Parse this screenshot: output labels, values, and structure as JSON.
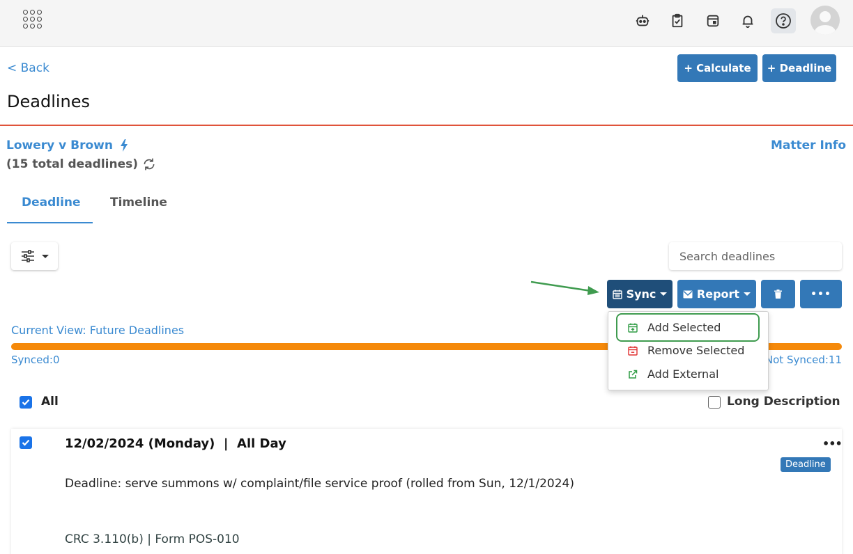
{
  "topbar": {
    "icons": [
      "apps-grid-icon",
      "robot-icon",
      "clipboard-check-icon",
      "calendar-widget-icon",
      "bell-icon",
      "help-icon",
      "avatar"
    ]
  },
  "header": {
    "back_label": "< Back",
    "calculate_label": "+ Calculate",
    "deadline_label": "+ Deadline",
    "title": "Deadlines"
  },
  "matter": {
    "name": "Lowery v Brown",
    "count": "(15 total deadlines)",
    "info_label": "Matter Info"
  },
  "tabs": [
    {
      "label": "Deadline",
      "active": true
    },
    {
      "label": "Timeline",
      "active": false
    }
  ],
  "search": {
    "placeholder": "Search deadlines"
  },
  "actions": {
    "sync_label": "Sync",
    "report_label": "Report",
    "delete_icon": "trash-icon",
    "more_label": "•••"
  },
  "sync_menu": {
    "items": [
      {
        "label": "Add Selected",
        "icon": "calendar-plus-icon",
        "color": "#2e9b43"
      },
      {
        "label": "Remove Selected",
        "icon": "calendar-minus-icon",
        "color": "#e03131"
      },
      {
        "label": "Add External",
        "icon": "external-link-icon",
        "color": "#2e9b43"
      }
    ]
  },
  "view": {
    "current": "Current View: Future Deadlines",
    "synced": "Synced:0",
    "not_synced": "Not Synced:11",
    "sync_progress": 0.0
  },
  "selection": {
    "all_label": "All",
    "all_checked": true,
    "long_description_label": "Long Description",
    "long_description_checked": false
  },
  "deadline": {
    "checked": true,
    "date": "12/02/2024 (Monday)  |  All Day",
    "more_label": "•••",
    "badge": "Deadline",
    "description": "Deadline: serve summons w/ complaint/file service proof (rolled from Sun, 12/1/2024)",
    "rule": "CRC 3.110(b) | Form POS-010"
  },
  "colors": {
    "primary": "#3378b7",
    "dark_primary": "#1f4e79",
    "link": "#3a8ad1",
    "accent_rule": "#e0533a",
    "progress": "#f5890a",
    "highlight": "#3f9b4f"
  }
}
